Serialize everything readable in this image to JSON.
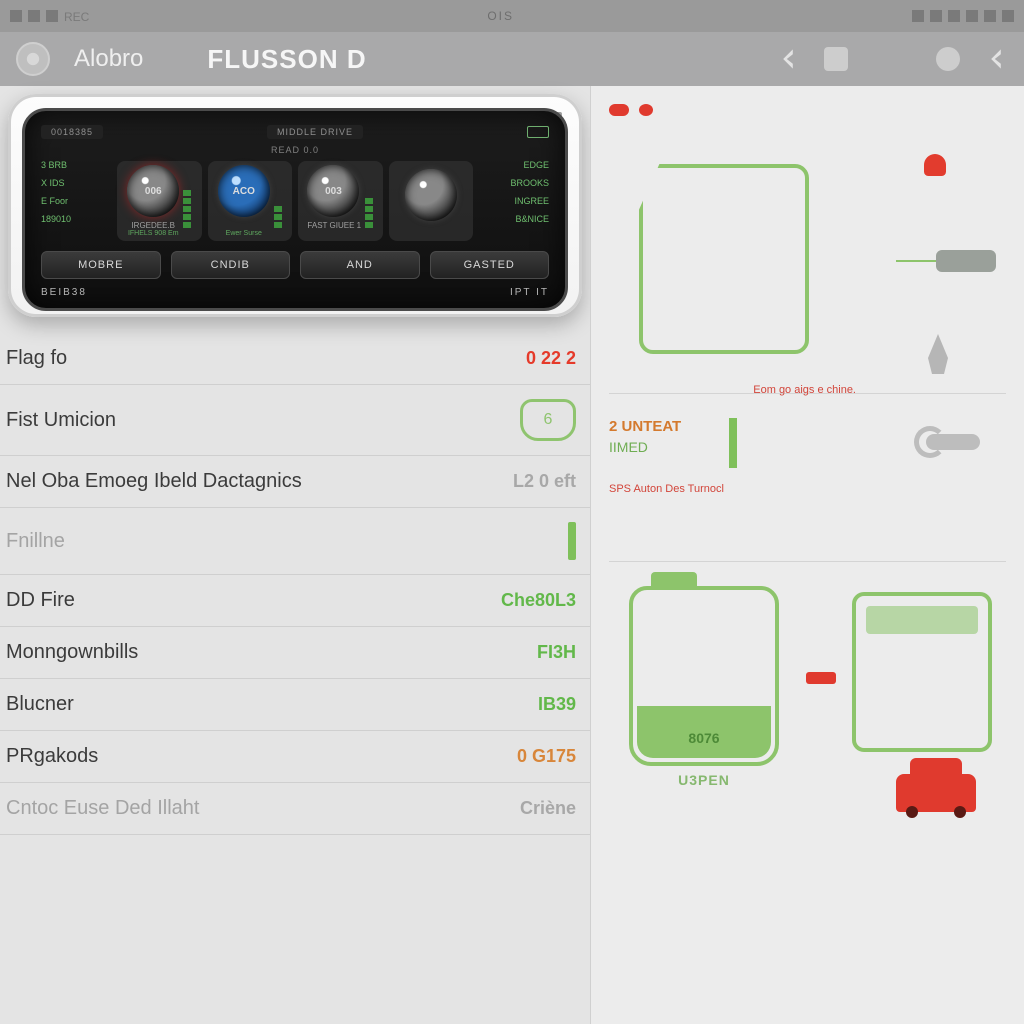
{
  "statusbar": {
    "left": "REC",
    "right": "OIS"
  },
  "topbar": {
    "app_name": "Alobro",
    "title": "FLUSSON D"
  },
  "device": {
    "top_pill_left": "0018385",
    "top_pill_right": "MIDDLE DRIVE",
    "subtitle": "READ 0.0",
    "left_stats": [
      "3 BRB",
      "X IDS",
      "E Foor",
      "189010"
    ],
    "right_stats": [
      "EDGE",
      "BROOKS",
      "INGREE",
      "B&NICE"
    ],
    "dials": [
      {
        "label": "006",
        "caption_top": "IRGEDEE.B",
        "caption_sub": "IFHELS 908 Em"
      },
      {
        "label": "ACO",
        "caption_top": "",
        "caption_sub": "Ewer Surse"
      },
      {
        "label": "003",
        "caption_top": "FAST GIUEE 1",
        "caption_sub": ""
      },
      {
        "label": "",
        "caption_top": "",
        "caption_sub": ""
      }
    ],
    "buttons": [
      "MOBRE",
      "CNDIB",
      "AND",
      "GASTED"
    ],
    "footer_left": "BEIB38",
    "footer_right": "IPT IT"
  },
  "list": [
    {
      "label": "Flag fo",
      "value": "0 22 2",
      "style": "red",
      "muted": false
    },
    {
      "label": "Fist Umicion",
      "value": "6",
      "style": "icon",
      "muted": false
    },
    {
      "label": "Nel Oba Emoeg Ibeld Dactagnics",
      "value": "L2 0 eft",
      "style": "grey",
      "muted": false
    },
    {
      "label": "Fnillne",
      "value": "",
      "style": "bar",
      "muted": true
    },
    {
      "label": "DD Fire",
      "value": "Che80L3",
      "style": "green",
      "muted": false
    },
    {
      "label": "Monngownbills",
      "value": "FI3H",
      "style": "green",
      "muted": false
    },
    {
      "label": "Blucner",
      "value": "IB39",
      "style": "green",
      "muted": false
    },
    {
      "label": "PRgakods",
      "value": "0 G175",
      "style": "orange",
      "muted": false
    },
    {
      "label": "Cntoc Euse Ded Illaht",
      "value": "Criène",
      "style": "grey",
      "muted": true
    }
  ],
  "right": {
    "diagram1_caption": "Eom go aigs e chine.",
    "section2": {
      "title": "2 UNTEAT",
      "sub": "IIMED",
      "caption": "SPS Auton Des Turnocl"
    },
    "section3": {
      "jug_label": "8076",
      "jug_label2": "U3PEN"
    }
  }
}
